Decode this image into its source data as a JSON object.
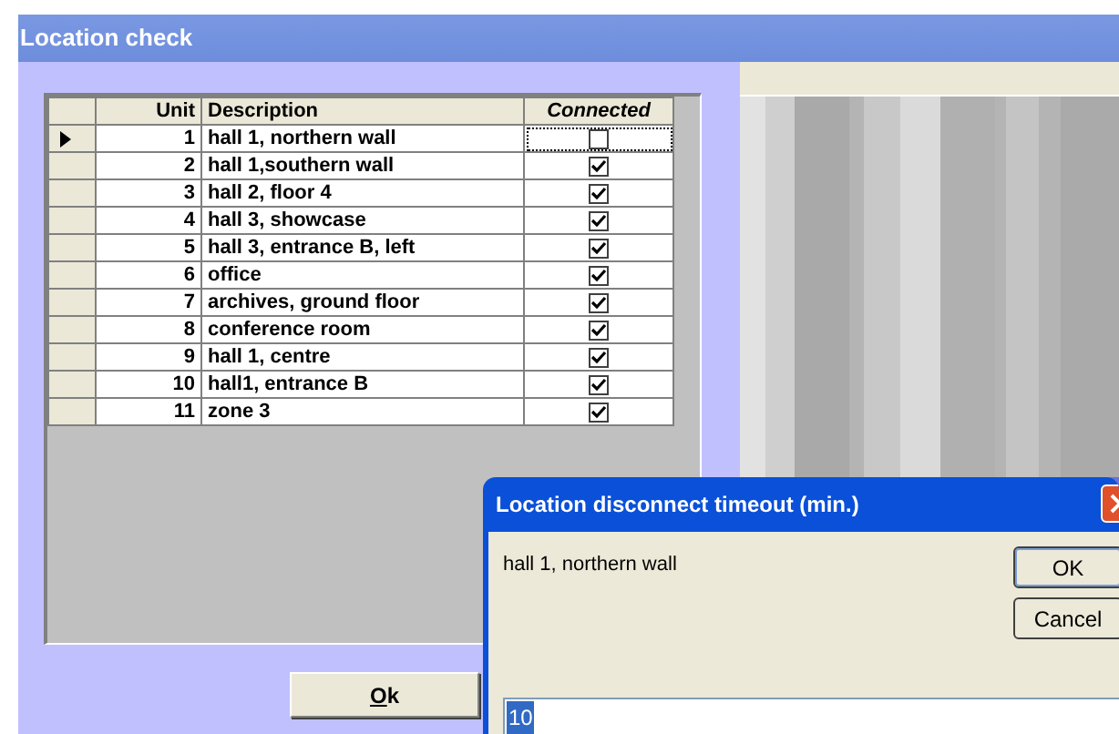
{
  "main_window": {
    "title": "Location check",
    "grid": {
      "columns": [
        "Unit",
        "Description",
        "Connected"
      ],
      "rows": [
        {
          "unit": "1",
          "description": "hall 1, northern wall",
          "connected": false,
          "selected": true
        },
        {
          "unit": "2",
          "description": "hall 1,southern wall",
          "connected": true,
          "selected": false
        },
        {
          "unit": "3",
          "description": "hall 2, floor 4",
          "connected": true,
          "selected": false
        },
        {
          "unit": "4",
          "description": "hall 3, showcase",
          "connected": true,
          "selected": false
        },
        {
          "unit": "5",
          "description": "hall 3, entrance B, left",
          "connected": true,
          "selected": false
        },
        {
          "unit": "6",
          "description": "office",
          "connected": true,
          "selected": false
        },
        {
          "unit": "7",
          "description": "archives, ground floor",
          "connected": true,
          "selected": false
        },
        {
          "unit": "8",
          "description": "conference room",
          "connected": true,
          "selected": false
        },
        {
          "unit": "9",
          "description": "hall 1, centre",
          "connected": true,
          "selected": false
        },
        {
          "unit": "10",
          "description": "hall1, entrance B",
          "connected": true,
          "selected": false
        },
        {
          "unit": "11",
          "description": "zone 3",
          "connected": true,
          "selected": false
        }
      ]
    },
    "button": "Ok"
  },
  "dialog": {
    "title": "Location disconnect timeout (min.)",
    "message": "hall 1, northern wall",
    "buttons": [
      "OK",
      "Cancel"
    ],
    "input": {
      "value": "10",
      "selected": true
    }
  }
}
